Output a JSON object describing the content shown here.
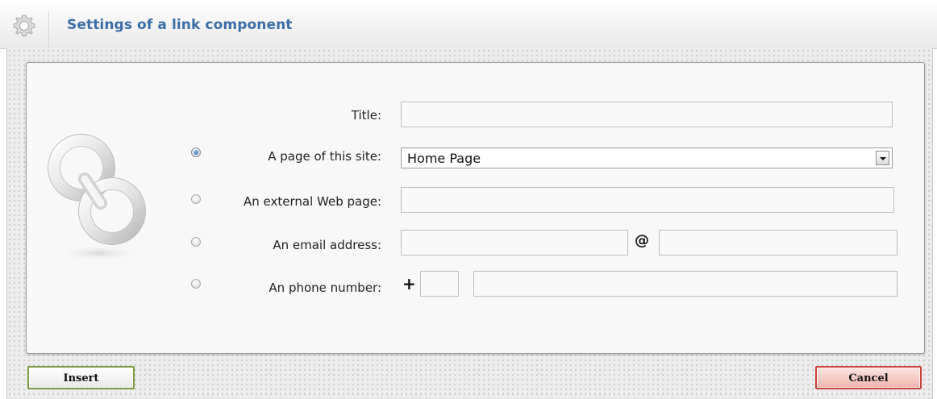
{
  "window": {
    "title": "Settings of a link component"
  },
  "form": {
    "title_label": "Title:",
    "title_value": "",
    "page_label": "A page of this site:",
    "page_selected": "Home Page",
    "external_label": "An external Web page:",
    "external_value": "",
    "email_label": "An email address:",
    "email_at": "@",
    "email_user_value": "",
    "email_domain_value": "",
    "phone_label": "An phone number:",
    "phone_plus": "+",
    "phone_code_value": "",
    "phone_number_value": "",
    "selected_option": "page"
  },
  "buttons": {
    "insert_label": "Insert",
    "cancel_label": "Cancel"
  },
  "icons": {
    "header": "gear-icon",
    "panel": "chain-link-icon",
    "dropdown": "chevron-down-icon"
  },
  "colors": {
    "title": "#3a6ea8",
    "insert_border": "#7d9a3c",
    "cancel_border": "#c9443b",
    "radio_selected": "#1e5f9c"
  }
}
